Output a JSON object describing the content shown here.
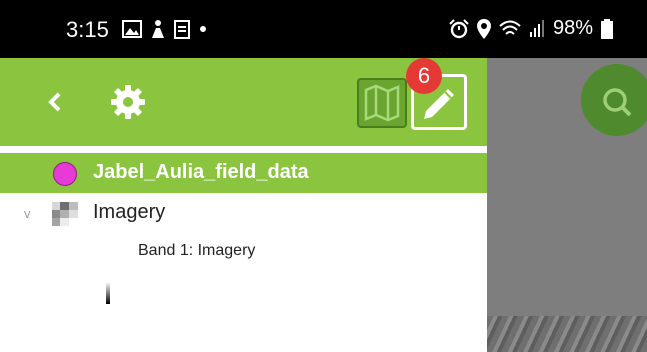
{
  "status_bar": {
    "time": "3:15",
    "battery": "98%",
    "icons": [
      "image-icon",
      "person-icon",
      "clipboard-icon",
      "dot-icon",
      "alarm-icon",
      "location-icon",
      "wifi-icon",
      "signal-icon",
      "battery-icon"
    ]
  },
  "toolbar": {
    "background": "#8bc540",
    "badge_count": "6",
    "icons": [
      "back-icon",
      "gear-icon",
      "map-icon",
      "edit-icon"
    ]
  },
  "layers": {
    "selected_layer": {
      "name": "Jabel_Aulia_field_data",
      "color": "#e63bd6"
    },
    "imagery": {
      "name": "Imagery",
      "band": "Band 1: Imagery"
    }
  },
  "map": {
    "search_icon": "search-icon",
    "fab_color": "#4f8a2e"
  }
}
